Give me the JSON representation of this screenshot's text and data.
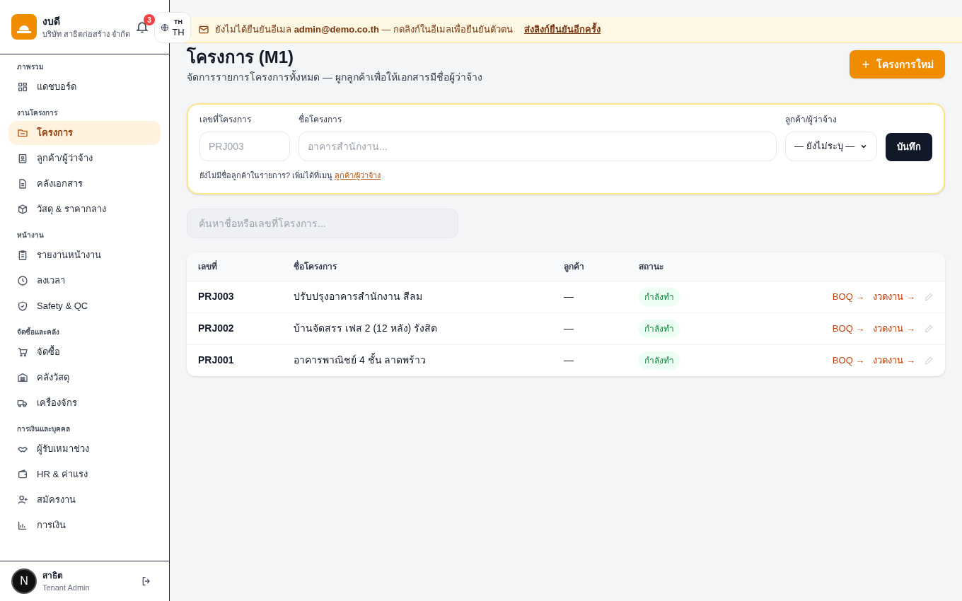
{
  "brand": {
    "name": "งบดี",
    "company": "บริษัท สาธิตก่อสร้าง จำกัด"
  },
  "notifications": {
    "count": "3"
  },
  "language": {
    "small": "TH",
    "current": "TH"
  },
  "banner": {
    "text": "ยังไม่ได้ยืนยันอีเมล **admin@demo.co.th** — กดลิงก์ในอีเมลเพื่อยืนยันตัวตน",
    "link": "ส่งลิงก์ยืนยันอีกครั้ง"
  },
  "sidebar": {
    "sections": [
      {
        "title": "ภาพรวม",
        "items": [
          {
            "label": "แดชบอร์ด",
            "selected": false
          }
        ]
      },
      {
        "title": "งานโครงการ",
        "items": [
          {
            "label": "โครงการ",
            "selected": true
          },
          {
            "label": "ลูกค้า/ผู้ว่าจ้าง",
            "selected": false
          },
          {
            "label": "คลังเอกสาร",
            "selected": false
          },
          {
            "label": "วัสดุ & ราคากลาง",
            "selected": false
          }
        ]
      },
      {
        "title": "หน้างาน",
        "items": [
          {
            "label": "รายงานหน้างาน",
            "selected": false
          },
          {
            "label": "ลงเวลา",
            "selected": false
          },
          {
            "label": "Safety & QC",
            "selected": false
          }
        ]
      },
      {
        "title": "จัดซื้อและคลัง",
        "items": [
          {
            "label": "จัดซื้อ",
            "selected": false
          },
          {
            "label": "คลังวัสดุ",
            "selected": false
          },
          {
            "label": "เครื่องจักร",
            "selected": false
          }
        ]
      },
      {
        "title": "การเงินและบุคคล",
        "items": [
          {
            "label": "ผู้รับเหมาช่วง",
            "selected": false
          },
          {
            "label": "HR & ค่าแรง",
            "selected": false
          },
          {
            "label": "สมัครงาน",
            "selected": false
          },
          {
            "label": "การเงิน",
            "selected": false
          }
        ]
      }
    ]
  },
  "user": {
    "name": "สาธิต",
    "role": "Tenant Admin",
    "badge": "N"
  },
  "page": {
    "title": "โครงการ (M1)",
    "subtitle": "จัดการรายการโครงการทั้งหมด — ผูกลูกค้าเพื่อให้เอกสารมีชื่อผู้ว่าจ้าง",
    "new_button": "โครงการใหม่"
  },
  "form": {
    "code_label": "เลขที่โครงการ",
    "code_placeholder": "PRJ003",
    "name_label": "ชื่อโครงการ",
    "name_placeholder": "อาคารสำนักงาน...",
    "client_label": "ลูกค้า/ผู้ว่าจ้าง",
    "client_value": "— ยังไม่ระบุ —",
    "save": "บันทึก",
    "hint": "ยังไม่มีชื่อลูกค้าในรายการ? เพิ่มได้ที่เมนู",
    "hint_link": "ลูกค้า/ผู้ว่าจ้าง"
  },
  "search": {
    "placeholder": "ค้นหาชื่อหรือเลขที่โครงการ..."
  },
  "table": {
    "columns": [
      "เลขที่",
      "ชื่อโครงการ",
      "ลูกค้า",
      "สถานะ"
    ],
    "rows": [
      {
        "code": "PRJ003",
        "name": "ปรับปรุงอาคารสำนักงาน สีลม",
        "client": "—",
        "status": "กำลังทำ",
        "boq": "BOQ →",
        "installments": "งวดงาน →"
      },
      {
        "code": "PRJ002",
        "name": "บ้านจัดสรร เฟส 2 (12 หลัง) รังสิต",
        "client": "—",
        "status": "กำลังทำ",
        "boq": "BOQ →",
        "installments": "งวดงาน →"
      },
      {
        "code": "PRJ001",
        "name": "อาคารพาณิชย์ 4 ชั้น ลาดพร้าว",
        "client": "—",
        "status": "กำลังทำ",
        "boq": "BOQ →",
        "installments": "งวดงาน →"
      }
    ]
  }
}
